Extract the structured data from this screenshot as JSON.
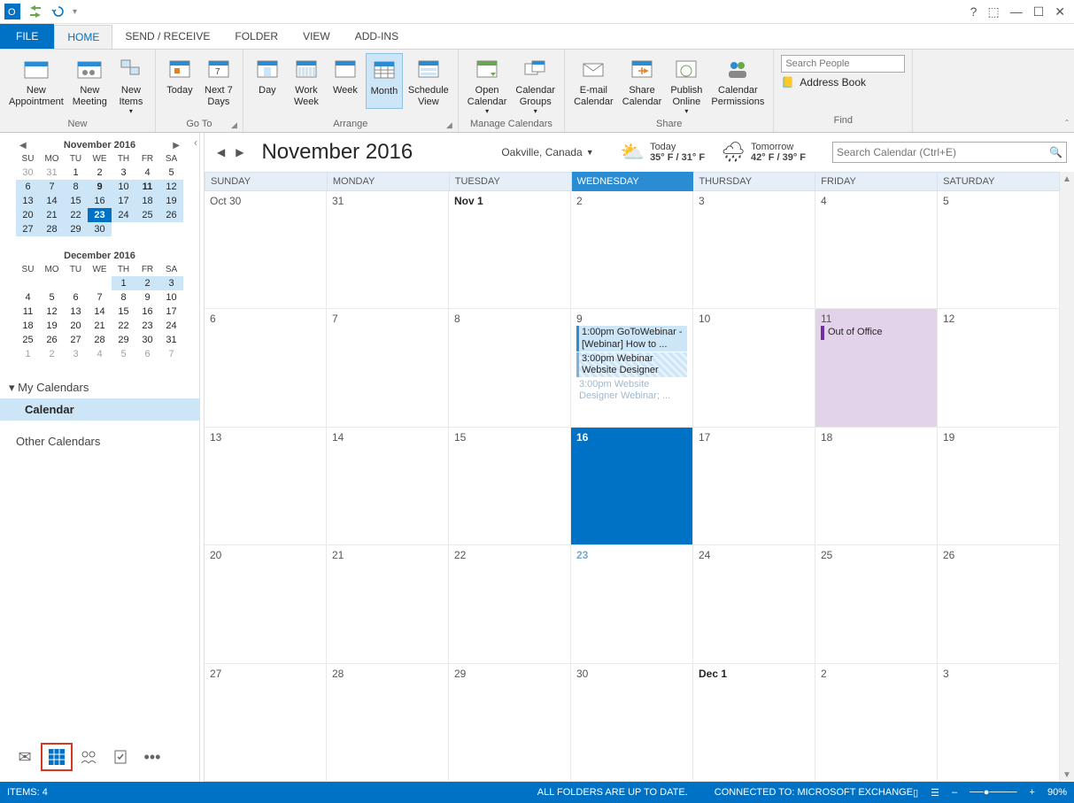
{
  "titlebar": {
    "help": "?",
    "minimize": "—",
    "maximize": "☐",
    "restore": "⬜",
    "close": "✕"
  },
  "tabs": {
    "file": "FILE",
    "home": "HOME",
    "sendreceive": "SEND / RECEIVE",
    "folder": "FOLDER",
    "view": "VIEW",
    "addins": "ADD-INS"
  },
  "ribbon": {
    "new": {
      "appointment": "New\nAppointment",
      "meeting": "New\nMeeting",
      "items": "New\nItems",
      "label": "New"
    },
    "goto": {
      "today": "Today",
      "next7": "Next 7\nDays",
      "label": "Go To"
    },
    "arrange": {
      "day": "Day",
      "workweek": "Work\nWeek",
      "week": "Week",
      "month": "Month",
      "schedule": "Schedule\nView",
      "label": "Arrange"
    },
    "manage": {
      "open": "Open\nCalendar",
      "groups": "Calendar\nGroups",
      "label": "Manage Calendars"
    },
    "share": {
      "email": "E-mail\nCalendar",
      "share": "Share\nCalendar",
      "publish": "Publish\nOnline",
      "perms": "Calendar\nPermissions",
      "label": "Share"
    },
    "find": {
      "search_placeholder": "Search People",
      "addressbook": "Address Book",
      "label": "Find"
    }
  },
  "mini1": {
    "title": "November 2016",
    "dow": [
      "SU",
      "MO",
      "TU",
      "WE",
      "TH",
      "FR",
      "SA"
    ],
    "rows": [
      [
        "30",
        "31",
        "1",
        "2",
        "3",
        "4",
        "5"
      ],
      [
        "6",
        "7",
        "8",
        "9",
        "10",
        "11",
        "12"
      ],
      [
        "13",
        "14",
        "15",
        "16",
        "17",
        "18",
        "19"
      ],
      [
        "20",
        "21",
        "22",
        "23",
        "24",
        "25",
        "26"
      ],
      [
        "27",
        "28",
        "29",
        "30",
        "",
        "",
        ""
      ]
    ]
  },
  "mini2": {
    "title": "December 2016",
    "dow": [
      "SU",
      "MO",
      "TU",
      "WE",
      "TH",
      "FR",
      "SA"
    ],
    "rows": [
      [
        "",
        "",
        "",
        "",
        "1",
        "2",
        "3"
      ],
      [
        "4",
        "5",
        "6",
        "7",
        "8",
        "9",
        "10"
      ],
      [
        "11",
        "12",
        "13",
        "14",
        "15",
        "16",
        "17"
      ],
      [
        "18",
        "19",
        "20",
        "21",
        "22",
        "23",
        "24"
      ],
      [
        "25",
        "26",
        "27",
        "28",
        "29",
        "30",
        "31"
      ],
      [
        "1",
        "2",
        "3",
        "4",
        "5",
        "6",
        "7"
      ]
    ]
  },
  "tree": {
    "my": "My Calendars",
    "cal": "Calendar",
    "other": "Other Calendars"
  },
  "main": {
    "title": "November 2016",
    "location": "Oakville, Canada",
    "weather": {
      "today_label": "Today",
      "today_temp": "35° F / 31° F",
      "tomorrow_label": "Tomorrow",
      "tomorrow_temp": "42° F / 39° F"
    },
    "search_placeholder": "Search Calendar (Ctrl+E)",
    "dow": [
      "SUNDAY",
      "MONDAY",
      "TUESDAY",
      "WEDNESDAY",
      "THURSDAY",
      "FRIDAY",
      "SATURDAY"
    ],
    "weeks": [
      [
        {
          "d": "Oct 30"
        },
        {
          "d": "31"
        },
        {
          "d": "Nov 1",
          "bold": true
        },
        {
          "d": "2"
        },
        {
          "d": "3"
        },
        {
          "d": "4"
        },
        {
          "d": "5"
        }
      ],
      [
        {
          "d": "6"
        },
        {
          "d": "7"
        },
        {
          "d": "8"
        },
        {
          "d": "9"
        },
        {
          "d": "10"
        },
        {
          "d": "11",
          "purple": true
        },
        {
          "d": "12"
        }
      ],
      [
        {
          "d": "13"
        },
        {
          "d": "14"
        },
        {
          "d": "15"
        },
        {
          "d": "16",
          "selected": true
        },
        {
          "d": "17"
        },
        {
          "d": "18"
        },
        {
          "d": "19"
        }
      ],
      [
        {
          "d": "20"
        },
        {
          "d": "21"
        },
        {
          "d": "22"
        },
        {
          "d": "23",
          "todaylbl": true
        },
        {
          "d": "24"
        },
        {
          "d": "25"
        },
        {
          "d": "26"
        }
      ],
      [
        {
          "d": "27"
        },
        {
          "d": "28"
        },
        {
          "d": "29"
        },
        {
          "d": "30"
        },
        {
          "d": "Dec 1",
          "bold": true
        },
        {
          "d": "2"
        },
        {
          "d": "3"
        }
      ]
    ],
    "events": {
      "e1": "1:00pm GoToWebinar - [Webinar] How to ...",
      "e2": "3:00pm Webinar Website Designer",
      "e3": "3:00pm Website Designer Webinar; ...",
      "e4": "Out of Office"
    }
  },
  "status": {
    "items": "ITEMS: 4",
    "folders": "ALL FOLDERS ARE UP TO DATE.",
    "connected": "CONNECTED TO: MICROSOFT EXCHANGE",
    "zoom": "90%"
  }
}
